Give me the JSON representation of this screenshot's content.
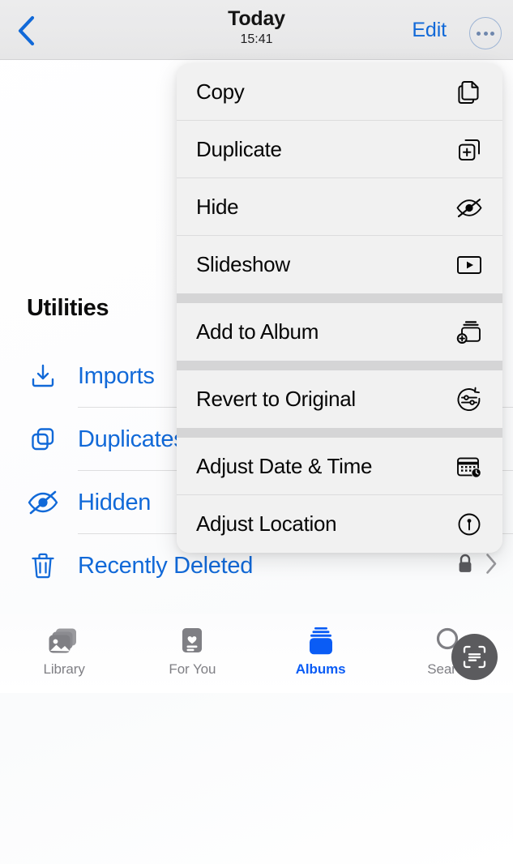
{
  "navbar": {
    "back_icon": "chevron-left-icon",
    "title": "Today",
    "subtitle": "15:41",
    "edit_label": "Edit",
    "more_icon": "ellipsis-circle-icon"
  },
  "sidebar": {
    "section_title": "Utilities",
    "items": [
      {
        "label": "Imports",
        "icon": "import-tray-icon",
        "trailing": []
      },
      {
        "label": "Duplicates",
        "icon": "duplicate-icon",
        "trailing": []
      },
      {
        "label": "Hidden",
        "icon": "eye-slash-icon",
        "trailing": []
      },
      {
        "label": "Recently Deleted",
        "icon": "trash-icon",
        "trailing": [
          "lock-icon",
          "chevron-right-icon"
        ]
      }
    ]
  },
  "context_menu": {
    "groups": [
      {
        "items": [
          {
            "label": "Copy",
            "icon": "copy-docs-icon"
          },
          {
            "label": "Duplicate",
            "icon": "duplicate-plus-icon"
          },
          {
            "label": "Hide",
            "icon": "eye-slash-icon"
          },
          {
            "label": "Slideshow",
            "icon": "play-rectangle-icon"
          }
        ]
      },
      {
        "items": [
          {
            "label": "Add to Album",
            "icon": "add-to-album-icon"
          }
        ]
      },
      {
        "items": [
          {
            "label": "Revert to Original",
            "icon": "revert-arrow-icon"
          }
        ]
      },
      {
        "items": [
          {
            "label": "Adjust Date & Time",
            "icon": "calendar-clock-icon"
          },
          {
            "label": "Adjust Location",
            "icon": "location-pin-circle-icon"
          }
        ]
      }
    ]
  },
  "tabbar": {
    "tabs": [
      {
        "label": "Library",
        "icon": "photo-stack-icon",
        "active": false
      },
      {
        "label": "For You",
        "icon": "heart-card-icon",
        "active": false
      },
      {
        "label": "Albums",
        "icon": "albums-stack-icon",
        "active": true
      },
      {
        "label": "Search",
        "icon": "search-icon",
        "active": false
      }
    ]
  },
  "floating_action": {
    "icon": "live-text-scan-icon"
  },
  "colors": {
    "accent_blue": "#1169d8",
    "tab_active_blue": "#0a5cf5",
    "inactive_gray": "#7f7f84",
    "menu_bg": "#f1f1f1",
    "menu_divider": "#dcdcdd",
    "group_divider": "#d5d5d6",
    "navbar_bg": "#e9e9ea"
  }
}
